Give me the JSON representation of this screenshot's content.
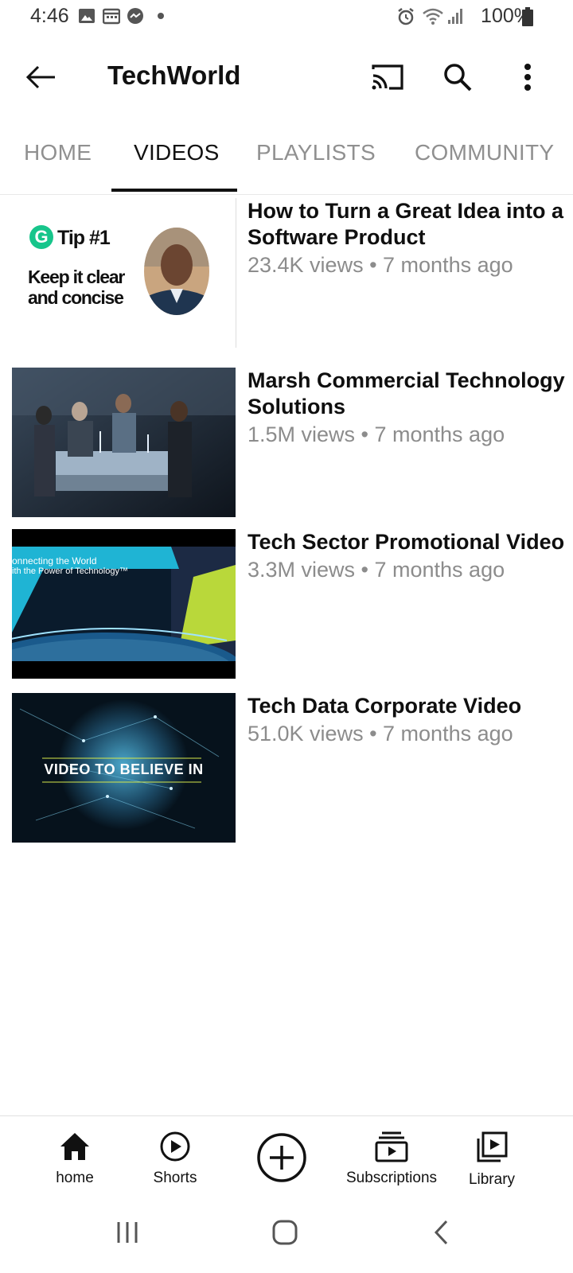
{
  "status_bar": {
    "time": "4:46",
    "battery": "100%",
    "icons": [
      "gallery-icon",
      "calendar-icon",
      "messenger-icon",
      "dot-icon",
      "alarm-icon",
      "wifi-icon",
      "signal-icon",
      "battery-icon"
    ]
  },
  "app_bar": {
    "title": "TechWorld",
    "icons": [
      "back-arrow-icon",
      "cast-icon",
      "search-icon",
      "more-vert-icon"
    ]
  },
  "tabs": [
    {
      "label": "HOME",
      "active": false
    },
    {
      "label": "VIDEOS",
      "active": true
    },
    {
      "label": "PLAYLISTS",
      "active": false
    },
    {
      "label": "COMMUNITY",
      "active": false
    }
  ],
  "videos": [
    {
      "title": "How to Turn a Great Idea into a Software Product",
      "meta": "23.4K views • 7 months ago",
      "thumb_text": {
        "badge": "G",
        "tip": "Tip #1",
        "line1": "Keep it clear",
        "line2": "and concise"
      }
    },
    {
      "title": "Marsh Commercial Technology Solutions",
      "meta": "1.5M views • 7 months ago"
    },
    {
      "title": "Tech Sector Promotional Video",
      "meta": "3.3M views • 7 months ago",
      "thumb_text": {
        "line1": "onnecting the World",
        "line2": "ith the Power of Technology™"
      }
    },
    {
      "title": "Tech Data Corporate Video",
      "meta": "51.0K views • 7 months ago",
      "thumb_text": {
        "banner": "VIDEO TO BELIEVE IN"
      }
    }
  ],
  "bottom_nav": [
    {
      "label": "home",
      "icon": "home-icon",
      "active": true
    },
    {
      "label": "Shorts",
      "icon": "shorts-icon",
      "active": false
    },
    {
      "label": "",
      "icon": "create-icon",
      "active": false
    },
    {
      "label": "Subscriptions",
      "icon": "subscriptions-icon",
      "active": false
    },
    {
      "label": "Library",
      "icon": "library-icon",
      "active": false
    }
  ],
  "system_nav": [
    "recents-icon",
    "home-circle-icon",
    "back-chevron-icon"
  ]
}
